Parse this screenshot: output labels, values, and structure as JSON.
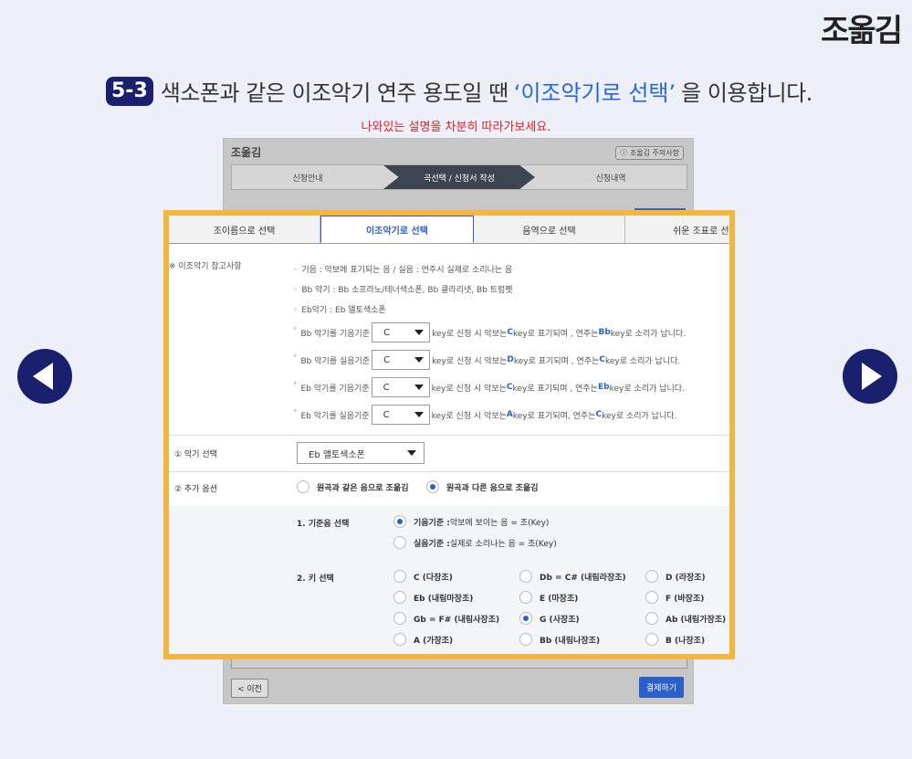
{
  "brand": "조옮김",
  "step": {
    "badge": "5-3",
    "text_before": "색소폰과 같은 이조악기 연주 용도일 땐",
    "highlight": "‘이조악기로 선택’",
    "text_after": "을 이용합니다."
  },
  "hint": "나와있는 설명을 차분히 따라가보세요.",
  "bg_app": {
    "title": "조옮김",
    "notice": "ⓘ 조옮김 주의사항",
    "steps": [
      "신청안내",
      "곡선택 / 신청서 작성",
      "신청내역"
    ],
    "prev": "< 이전",
    "pay": "결제하기"
  },
  "tabs": [
    "조이름으로 선택",
    "이조악기로 선택",
    "음역으로 선택",
    "쉬운 조표로 선택"
  ],
  "reference": {
    "label": "※ 이조악기 참고사항",
    "lines": [
      "기음 : 악보에 표기되는 음 / 실음 : 연주시 실제로 소리나는 음",
      "Bb 악기 : Bb 소프라노/테너색소폰, Bb 클라리넷, Bb 트럼펫",
      "Eb악기 : Eb 앨토색소폰"
    ],
    "rows": [
      {
        "prefix": "Bb 악기를 기음기준",
        "value": "C",
        "mid": "key로 신청 시 악보는",
        "k1": "C",
        "mid2": "key로 표기되며 , 연주는",
        "k2": "Bb",
        "suffix": "key로 소리가 납니다."
      },
      {
        "prefix": "Bb 악기를 실음기준",
        "value": "C",
        "mid": "key로 신청 시 악보는",
        "k1": "D",
        "mid2": "key로 표기되며 , 연주는",
        "k2": "C",
        "suffix": "key로 소리가 납니다."
      },
      {
        "prefix": "Eb 악기를 기음기준",
        "value": "C",
        "mid": "key로 신청 시 악보는",
        "k1": "C",
        "mid2": "key로 표기되며 , 연주는",
        "k2": "Eb",
        "suffix": "key로 소리가 납니다."
      },
      {
        "prefix": "Eb 악기를 실음기준",
        "value": "C",
        "mid": "key로 신청 시 악보는",
        "k1": "A",
        "mid2": "key로 표기되며, 연주는",
        "k2": "C",
        "suffix": "key로 소리가 납니다."
      }
    ]
  },
  "instrument": {
    "label": "① 악기 선택",
    "selected": "Eb 앨토색소폰"
  },
  "extra": {
    "label": "② 추가 옵션",
    "options": [
      "원곡과 같은 음으로 조옮김",
      "원곡과 다른 음으로 조옮김"
    ],
    "selected_index": 1
  },
  "base_note": {
    "label": "1. 기준음 선택",
    "options": [
      {
        "bold": "기음기준 :",
        "rest": " 악보에 보이는 음 = 조(Key)"
      },
      {
        "bold": "실음기준 :",
        "rest": " 실제로 소리나는 음 = 조(Key)"
      }
    ],
    "selected_index": 0
  },
  "key_select": {
    "label": "2. 키 선택",
    "keys": [
      "C (다장조)",
      "Db = C# (내림라장조)",
      "D (라장조)",
      "Eb (내림마장조)",
      "E (마장조)",
      "F (바장조)",
      "Gb = F# (내림사장조)",
      "G (사장조)",
      "Ab (내림가장조)",
      "A (가장조)",
      "Bb (내림나장조)",
      "B (나장조)"
    ],
    "selected_index": 7
  },
  "colors": {
    "navy": "#1a1f6e",
    "highlight_blue": "#2b66d9",
    "frame_orange": "#f5b640",
    "hint_red": "#dd2222"
  }
}
